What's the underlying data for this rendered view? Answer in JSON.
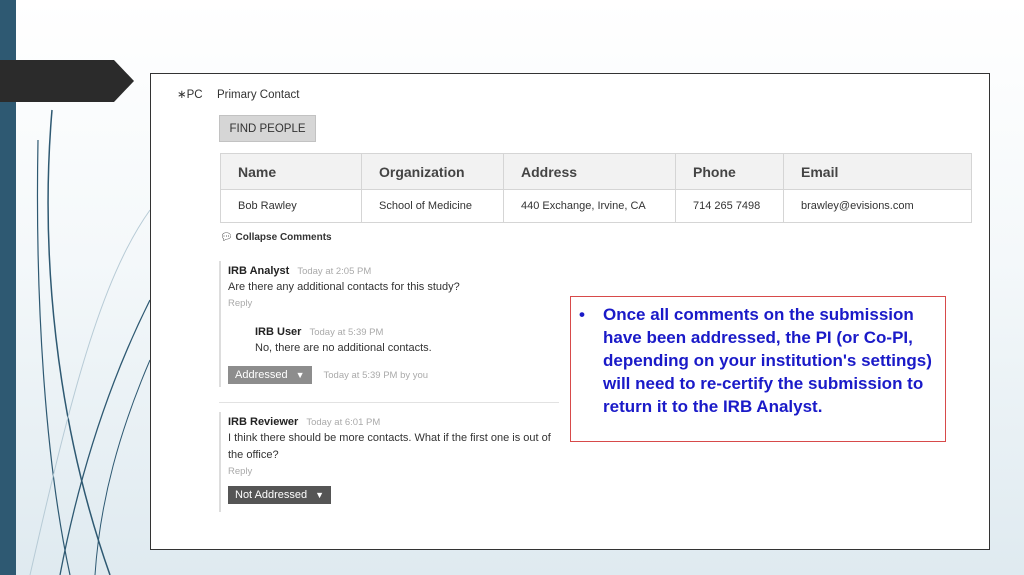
{
  "header_form": {
    "pc_req_label": "∗PC",
    "pc_field_label": "Primary Contact",
    "find_people_label": "FIND PEOPLE"
  },
  "contacts_table": {
    "columns": [
      "Name",
      "Organization",
      "Address",
      "Phone",
      "Email"
    ],
    "rows": [
      [
        "Bob Rawley",
        "School of Medicine",
        "440 Exchange, Irvine, CA",
        "714 265 7498",
        "brawley@evisions.com"
      ]
    ]
  },
  "comments": {
    "collapse_label": "Collapse Comments",
    "thread1": {
      "author": "IRB Analyst",
      "time": "Today at 2:05 PM",
      "message": "Are there any additional contacts for this study?",
      "reply_label": "Reply",
      "response": {
        "author": "IRB User",
        "time": "Today at 5:39 PM",
        "message": "No, there are no additional contacts."
      },
      "status_label": "Addressed",
      "status_time": "Today at 5:39 PM by you"
    },
    "thread2": {
      "author": "IRB Reviewer",
      "time": "Today at 6:01 PM",
      "message": "I think there should be more contacts.  What if the first one is out of the office?",
      "reply_label": "Reply",
      "status_label": "Not Addressed"
    }
  },
  "callout": {
    "bullet": "•",
    "text": "Once all comments on the submission have been addressed, the PI (or Co-PI, depending on your institution's settings) will need to re-certify the submission to return it to the IRB Analyst."
  },
  "colors": {
    "addressed_btn": "#8d8d8d",
    "not_addressed_btn": "#555555",
    "callout_text": "#1a1ac8",
    "callout_border": "#d74a4a"
  }
}
